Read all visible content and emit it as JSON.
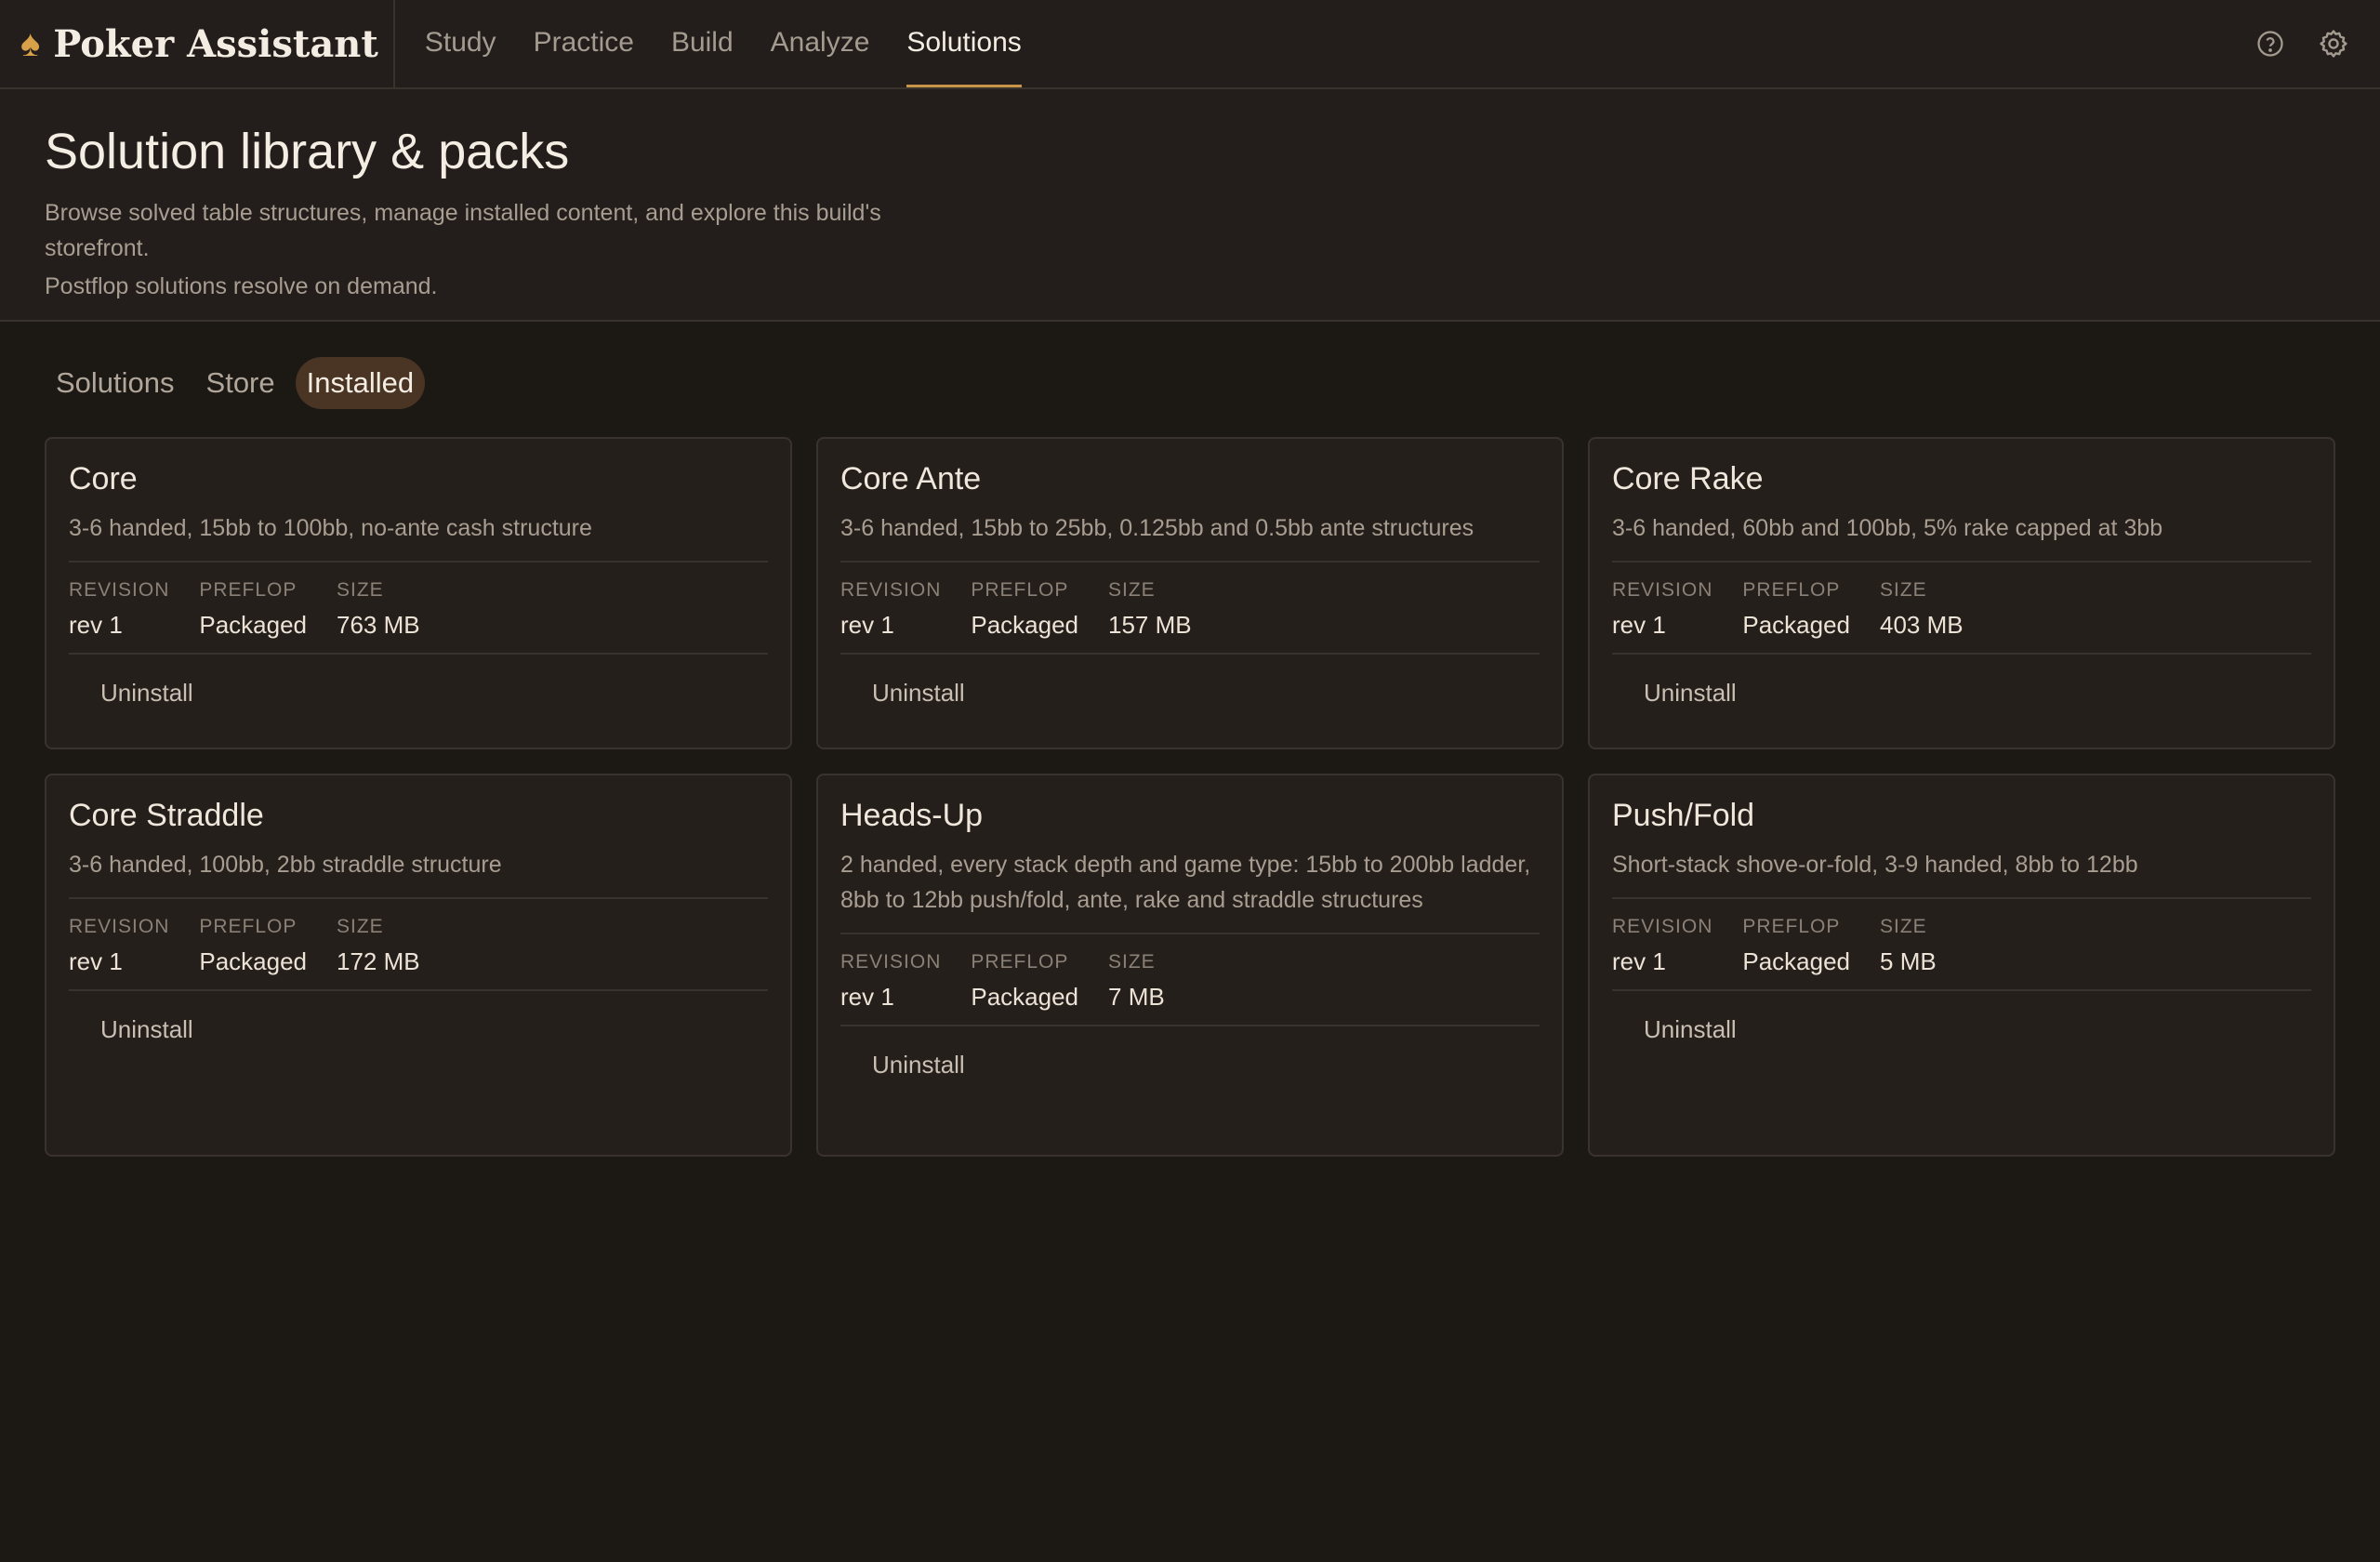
{
  "app": {
    "name": "Poker Assistant",
    "logo_icon": "spade-icon",
    "accent": "#c89548"
  },
  "nav": [
    {
      "label": "Study"
    },
    {
      "label": "Practice"
    },
    {
      "label": "Build"
    },
    {
      "label": "Analyze"
    },
    {
      "label": "Solutions",
      "active": true
    }
  ],
  "top_actions": {
    "help_icon": "help-icon",
    "settings_icon": "gear-icon"
  },
  "header": {
    "title": "Solution library & packs",
    "description": "Browse solved table structures, manage installed content, and explore this build's storefront.",
    "note": "Postflop solutions resolve on demand."
  },
  "tabs": [
    {
      "label": "Solutions"
    },
    {
      "label": "Store"
    },
    {
      "label": "Installed",
      "active": true
    }
  ],
  "meta_labels": {
    "revision": "REVISION",
    "preflop": "PREFLOP",
    "size": "SIZE"
  },
  "cards": [
    {
      "title": "Core",
      "description": "3-6 handed, 15bb to 100bb, no-ante cash structure",
      "revision": "rev 1",
      "preflop": "Packaged",
      "size": "763 MB",
      "action": "Uninstall"
    },
    {
      "title": "Core Ante",
      "description": "3-6 handed, 15bb to 25bb, 0.125bb and 0.5bb ante structures",
      "revision": "rev 1",
      "preflop": "Packaged",
      "size": "157 MB",
      "action": "Uninstall"
    },
    {
      "title": "Core Rake",
      "description": "3-6 handed, 60bb and 100bb, 5% rake capped at 3bb",
      "revision": "rev 1",
      "preflop": "Packaged",
      "size": "403 MB",
      "action": "Uninstall"
    },
    {
      "title": "Core Straddle",
      "description": "3-6 handed, 100bb, 2bb straddle structure",
      "revision": "rev 1",
      "preflop": "Packaged",
      "size": "172 MB",
      "action": "Uninstall"
    },
    {
      "title": "Heads-Up",
      "description": "2 handed, every stack depth and game type: 15bb to 200bb ladder, 8bb to 12bb push/fold, ante, rake and straddle structures",
      "revision": "rev 1",
      "preflop": "Packaged",
      "size": "7 MB",
      "action": "Uninstall"
    },
    {
      "title": "Push/Fold",
      "description": "Short-stack shove-or-fold, 3-9 handed, 8bb to 12bb",
      "revision": "rev 1",
      "preflop": "Packaged",
      "size": "5 MB",
      "action": "Uninstall"
    }
  ]
}
